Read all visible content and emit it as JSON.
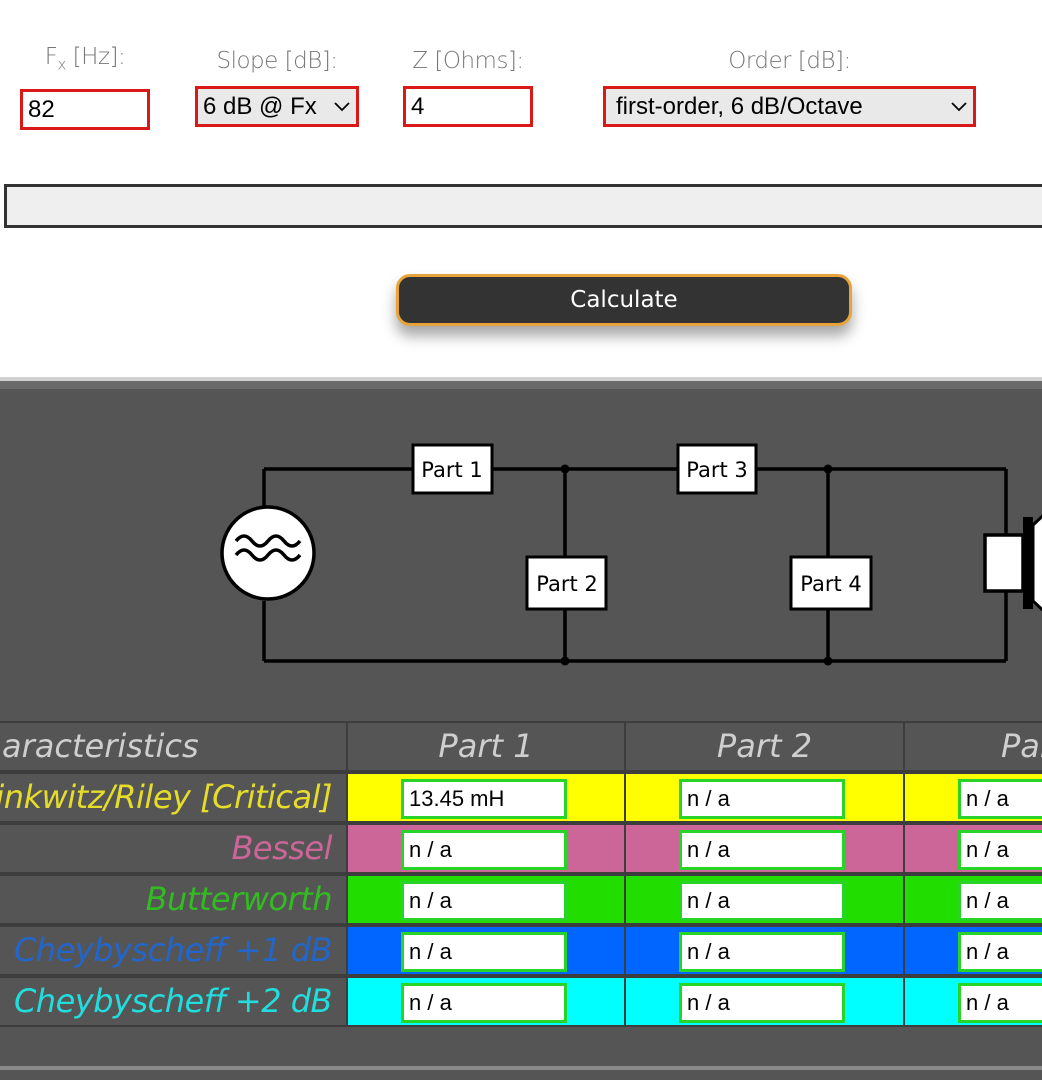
{
  "form": {
    "fx": {
      "label_main": "F",
      "label_sub": "x",
      "label_rest": " [Hz]:",
      "value": "82"
    },
    "slope": {
      "label": "Slope [dB]:",
      "value": "6 dB @ Fx"
    },
    "z": {
      "label": "Z [Ohms]:",
      "value": "4"
    },
    "order": {
      "label": "Order [dB]:",
      "value": "first-order, 6 dB/Octave"
    }
  },
  "calculate_label": "Calculate",
  "circuit": {
    "parts": [
      "Part 1",
      "Part 2",
      "Part 3",
      "Part 4"
    ],
    "source_icon": "ac-source-icon",
    "speaker_icon": "speaker-icon"
  },
  "table": {
    "headers": [
      "aracteristics",
      "Part 1",
      "Part 2",
      "Par"
    ],
    "rows": [
      {
        "label": "Linkwitz/Riley [Critical]",
        "label_color": "#e6dd2a",
        "bg": "#ffff00",
        "values": [
          "13.45 mH",
          "n / a",
          "n / a"
        ]
      },
      {
        "label": "Bessel",
        "label_color": "#cc6699",
        "bg": "#cc6699",
        "values": [
          "n / a",
          "n / a",
          "n / a"
        ]
      },
      {
        "label": "Butterworth",
        "label_color": "#33bb22",
        "bg": "#22dd00",
        "values": [
          "n / a",
          "n / a",
          "n / a"
        ]
      },
      {
        "label": "Cheybyscheff +1 dB",
        "label_color": "#2266cc",
        "bg": "#0066ff",
        "values": [
          "n / a",
          "n / a",
          "n / a"
        ]
      },
      {
        "label": "Cheybyscheff +2 dB",
        "label_color": "#22dddd",
        "bg": "#00ffff",
        "values": [
          "n / a",
          "n / a",
          "n / a"
        ]
      }
    ]
  }
}
